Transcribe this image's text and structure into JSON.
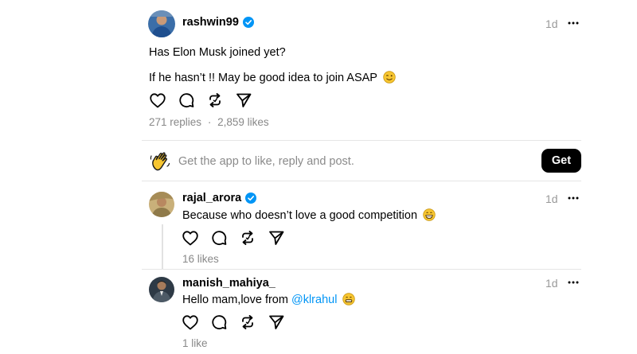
{
  "post": {
    "username": "rashwin99",
    "time": "1d",
    "line1": "Has Elon Musk joined yet?",
    "line2": "If he hasn’t !! May be good idea to join ASAP",
    "replies": "271 replies",
    "separator": "·",
    "likes": "2,859 likes"
  },
  "promo": {
    "text": "Get the app to like, reply and post.",
    "button": "Get"
  },
  "comments": [
    {
      "username": "rajal_arora",
      "time": "1d",
      "text": "Because who doesn’t love a good competition",
      "likes": "16 likes"
    },
    {
      "username": "manish_mahiya_",
      "time": "1d",
      "text_prefix": "Hello mam,love from ",
      "mention": "@klrahul",
      "likes": "1 like"
    }
  ],
  "colors": {
    "verified": "#0095f6",
    "mention": "#0095f6",
    "muted": "#999999"
  }
}
